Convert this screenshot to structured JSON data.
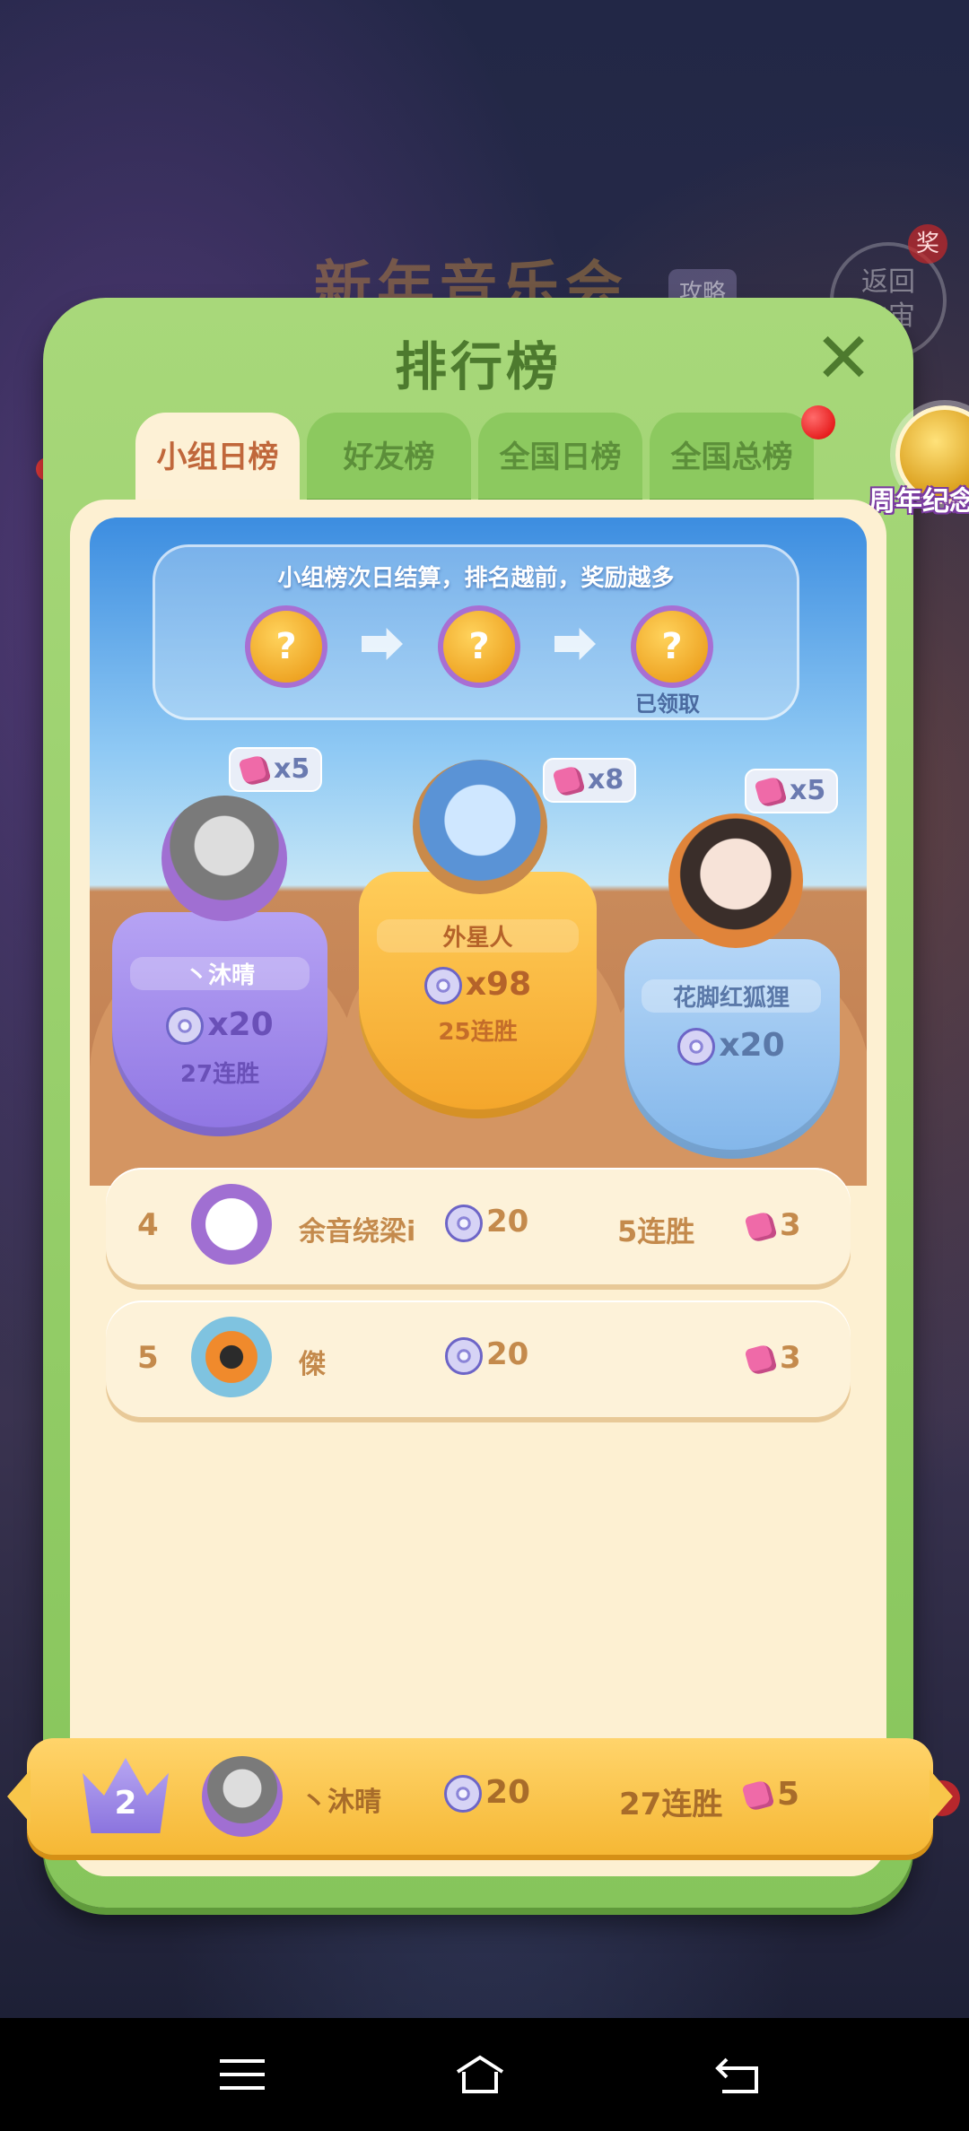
{
  "background": {
    "event_title": "新年音乐会",
    "event_tag": "攻略",
    "return_button": "返回\n主宙",
    "reward_badge": "奖"
  },
  "panel": {
    "title": "排行榜",
    "tabs": [
      {
        "label": "小组日榜",
        "active": true
      },
      {
        "label": "好友榜",
        "active": false
      },
      {
        "label": "全国日榜",
        "active": false
      },
      {
        "label": "全国总榜",
        "active": false
      }
    ],
    "coin_badge_label": "周年纪念币"
  },
  "info": {
    "text": "小组榜次日结算，排名越前，奖励越多",
    "claimed": "已领取"
  },
  "podium": [
    {
      "place": 2,
      "name": "丶沐晴",
      "discs": "x20",
      "streak": "27连胜",
      "gems": "x5",
      "color": "#9d84ec"
    },
    {
      "place": 1,
      "name": "外星人",
      "discs": "x98",
      "streak": "25连胜",
      "gems": "x8",
      "color": "#f7b53a"
    },
    {
      "place": 3,
      "name": "花脚红狐狸",
      "discs": "x20",
      "streak": "",
      "gems": "x5",
      "color": "#8fc2f0"
    }
  ],
  "rows": [
    {
      "rank": "4",
      "name": "余音绕梁i",
      "discs": "20",
      "streak": "5连胜",
      "gems": "3"
    },
    {
      "rank": "5",
      "name": "傑",
      "discs": "20",
      "streak": "",
      "gems": "3"
    }
  ],
  "me": {
    "rank": "2",
    "name": "丶沐晴",
    "discs": "20",
    "streak": "27连胜",
    "gems": "5"
  }
}
